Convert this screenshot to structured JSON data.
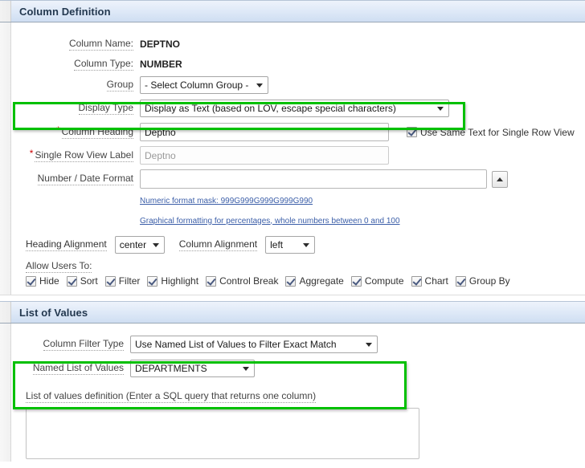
{
  "column_definition": {
    "title": "Column Definition",
    "column_name": {
      "label": "Column Name:",
      "value": "DEPTNO"
    },
    "column_type": {
      "label": "Column Type:",
      "value": "NUMBER"
    },
    "group": {
      "label": "Group",
      "value": "- Select Column Group -"
    },
    "display_type": {
      "label": "Display Type",
      "value": "Display as Text (based on LOV, escape special characters)"
    },
    "column_heading": {
      "label": "Column Heading",
      "value": "Deptno",
      "required": "*"
    },
    "single_row_view_label": {
      "label": "Single Row View Label",
      "value": "Deptno",
      "required": "*"
    },
    "use_same_text": {
      "label": "Use Same Text for Single Row View",
      "checked": true
    },
    "number_date_format": {
      "label": "Number / Date Format",
      "value": "",
      "spinner_icon": "chevron-up-icon"
    },
    "numeric_format_mask_link": "Numeric format mask: 999G999G999G999G990",
    "graphical_formatting_link": "Graphical formatting for percentages, whole numbers between 0 and 100",
    "heading_alignment": {
      "label": "Heading Alignment",
      "value": "center"
    },
    "column_alignment": {
      "label": "Column Alignment",
      "value": "left"
    },
    "allow_users_to": {
      "label": "Allow Users To:",
      "options": [
        {
          "label": "Hide",
          "checked": true
        },
        {
          "label": "Sort",
          "checked": true
        },
        {
          "label": "Filter",
          "checked": true
        },
        {
          "label": "Highlight",
          "checked": true
        },
        {
          "label": "Control Break",
          "checked": true
        },
        {
          "label": "Aggregate",
          "checked": true
        },
        {
          "label": "Compute",
          "checked": true
        },
        {
          "label": "Chart",
          "checked": true
        },
        {
          "label": "Group By",
          "checked": true
        }
      ]
    }
  },
  "list_of_values": {
    "title": "List of Values",
    "column_filter_type": {
      "label": "Column Filter Type",
      "value": "Use Named List of Values to Filter Exact Match"
    },
    "named_list_of_values": {
      "label": "Named List of Values",
      "value": "DEPARTMENTS"
    },
    "lov_definition": {
      "label": "List of values definition (Enter a SQL query that returns one column)",
      "value": ""
    }
  },
  "annotations": {
    "highlight_color": "#00c000",
    "boxes": [
      {
        "name": "display-type-highlight"
      },
      {
        "name": "lov-fields-highlight"
      }
    ]
  }
}
